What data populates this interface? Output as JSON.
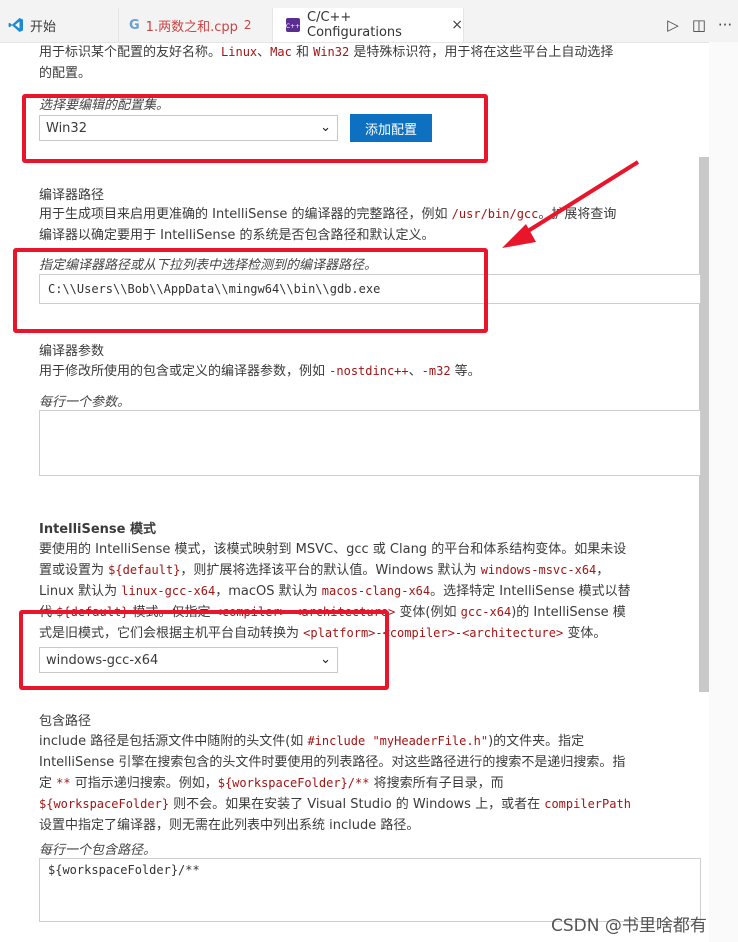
{
  "tabs": {
    "home": {
      "label": "开始"
    },
    "cpp": {
      "label": "1.两数之和.cpp",
      "badge": "2"
    },
    "config": {
      "label": "C/C++ Configurations",
      "close": "×"
    }
  },
  "actions": {
    "run": "▷",
    "split": "◫",
    "more": "···"
  },
  "top_desc": {
    "line1_a": "用于标识某个配置的友好名称。",
    "line1_linux": "Linux",
    "line1_sep": "、",
    "line1_mac": "Mac",
    "line1_and": " 和 ",
    "line1_win32": "Win32",
    "line1_b": " 是特殊标识符，用于将在这些平台上自动选择",
    "line2": "的配置。"
  },
  "config_select": {
    "hint": "选择要编辑的配置集。",
    "value": "Win32",
    "add_button": "添加配置"
  },
  "compiler_path": {
    "title": "编译器路径",
    "desc1_a": "用于生成项目来启用更准确的 IntelliSense 的编译器的完整路径，例如 ",
    "desc1_code": "/usr/bin/gcc",
    "desc1_b": "。扩展将查询",
    "desc2": "编译器以确定要用于 IntelliSense 的系统是否包含路径和默认定义。",
    "hint": "指定编译器路径或从下拉列表中选择检测到的编译器路径。",
    "value": "C:\\\\Users\\\\Bob\\\\AppData\\\\mingw64\\\\bin\\\\gdb.exe"
  },
  "compiler_args": {
    "title": "编译器参数",
    "desc_a": "用于修改所使用的包含或定义的编译器参数，例如 ",
    "desc_code1": "-nostdinc++",
    "desc_sep": "、",
    "desc_code2": "-m32",
    "desc_b": " 等。",
    "hint": "每行一个参数。"
  },
  "intellisense": {
    "title": "IntelliSense 模式",
    "l1": "要使用的 IntelliSense 模式，该模式映射到 MSVC、gcc 或 Clang 的平台和体系结构变体。如果未设",
    "l2_a": "置或设置为 ",
    "l2_code": "${default}",
    "l2_b": "，则扩展将选择该平台的默认值。Windows 默认为 ",
    "l2_code2": "windows-msvc-x64",
    "l2_c": "，",
    "l3_a": "Linux 默认为 ",
    "l3_code": "linux-gcc-x64",
    "l3_b": "，macOS 默认为 ",
    "l3_code2": "macos-clang-x64",
    "l3_c": "。选择特定 IntelliSense 模式以替",
    "l4_a": "代 ",
    "l4_code": "${default}",
    "l4_b": " 模式。仅指定 ",
    "l4_code2": "<compiler>-<architecture>",
    "l4_c": " 变体(例如 ",
    "l4_code3": "gcc-x64",
    "l4_d": ")的 IntelliSense 模",
    "l5_a": "式是旧模式，它们会根据主机平台自动转换为 ",
    "l5_code": "<platform>-<compiler>-<architecture>",
    "l5_b": " 变体。",
    "value": "windows-gcc-x64"
  },
  "include_path": {
    "title": "包含路径",
    "l1_a": "include 路径是包括源文件中随附的头文件(如 ",
    "l1_code": "#include \"myHeaderFile.h\"",
    "l1_b": ")的文件夹。指定",
    "l2": "IntelliSense 引擎在搜索包含的头文件时要使用的列表路径。对这些路径进行的搜索不是递归搜索。指",
    "l3_a": "定 ",
    "l3_code": "**",
    "l3_b": " 可指示递归搜索。例如，",
    "l3_code2": "${workspaceFolder}/**",
    "l3_c": " 将搜索所有子目录，而",
    "l4_code": "${workspaceFolder}",
    "l4_a": " 则不会。如果在安装了 Visual Studio 的 Windows 上，或者在 ",
    "l4_code2": "compilerPath",
    "l5": "设置中指定了编译器，则无需在此列表中列出系统 include 路径。",
    "hint": "每行一个包含路径。",
    "value": "${workspaceFolder}/**"
  },
  "watermark": "CSDN @书里啥都有"
}
